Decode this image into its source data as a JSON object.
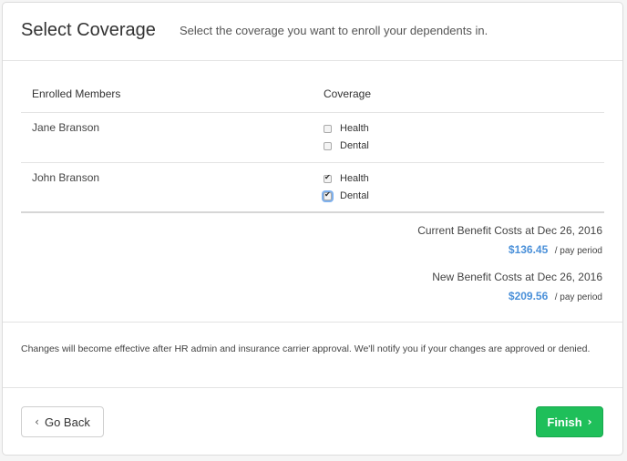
{
  "header": {
    "title": "Select Coverage",
    "subtitle": "Select the coverage you want to enroll your dependents in."
  },
  "table": {
    "headers": {
      "members": "Enrolled Members",
      "coverage": "Coverage"
    },
    "rows": [
      {
        "name": "Jane Branson",
        "coverage": [
          {
            "label": "Health",
            "checked": false
          },
          {
            "label": "Dental",
            "checked": false
          }
        ]
      },
      {
        "name": "John Branson",
        "coverage": [
          {
            "label": "Health",
            "checked": true
          },
          {
            "label": "Dental",
            "checked": true,
            "focused": true
          }
        ]
      }
    ]
  },
  "costs": {
    "current": {
      "label": "Current Benefit Costs at Dec 26, 2016",
      "amount": "$136.45",
      "unit": "/ pay period"
    },
    "new": {
      "label": "New Benefit Costs at Dec 26, 2016",
      "amount": "$209.56",
      "unit": "/ pay period"
    }
  },
  "note": "Changes will become effective after HR admin and insurance carrier approval. We'll notify you if your changes are approved or denied.",
  "buttons": {
    "back": {
      "label": "Go Back",
      "icon": "chevron-left-icon"
    },
    "finish": {
      "label": "Finish",
      "icon": "chevron-right-icon"
    }
  },
  "colors": {
    "accent": "#4a90d9",
    "finish": "#1fbf5a"
  }
}
